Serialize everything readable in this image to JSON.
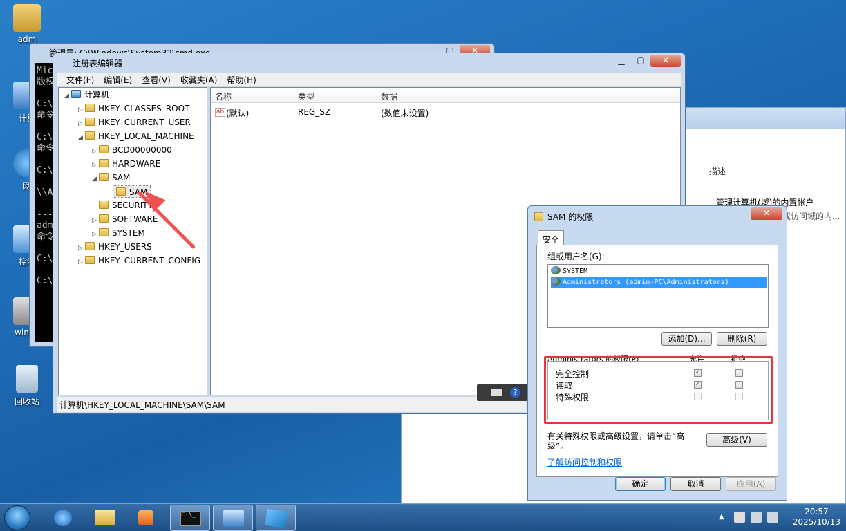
{
  "desktop": {
    "icons": [
      "adm",
      "计算",
      "网",
      "控制",
      "windo",
      "回收站"
    ]
  },
  "background_window": {
    "column_header": "描述",
    "row1": "管理计算机(域)的内置帐户",
    "row2": "供来宾访问计算机或访问域的内..."
  },
  "cmd": {
    "title": "管理员: C:\\Windows\\System32\\cmd.exe",
    "lines": [
      "Mic",
      "版权",
      "",
      "C:\\",
      "命令",
      "",
      "C:\\",
      "命令",
      "",
      "C:\\",
      "",
      "\\\\A",
      "",
      "---",
      "adm",
      "命令",
      "",
      "C:\\",
      "",
      "C:\\"
    ]
  },
  "regedit": {
    "title": "注册表编辑器",
    "menu": [
      "文件(F)",
      "编辑(E)",
      "查看(V)",
      "收藏夹(A)",
      "帮助(H)"
    ],
    "tree": {
      "root": "计算机",
      "hkcr": "HKEY_CLASSES_ROOT",
      "hkcu": "HKEY_CURRENT_USER",
      "hklm": "HKEY_LOCAL_MACHINE",
      "bcd": "BCD00000000",
      "hardware": "HARDWARE",
      "sam": "SAM",
      "sam_child": "SAM",
      "security": "SECURITY",
      "software": "SOFTWARE",
      "system": "SYSTEM",
      "hku": "HKEY_USERS",
      "hkcc": "HKEY_CURRENT_CONFIG"
    },
    "columns": {
      "name": "名称",
      "type": "类型",
      "data": "数据"
    },
    "row": {
      "name": "(默认)",
      "type": "REG_SZ",
      "data": "(数值未设置)",
      "icon": "ab"
    },
    "status": "计算机\\HKEY_LOCAL_MACHINE\\SAM\\SAM"
  },
  "perm_dialog": {
    "title": "SAM 的权限",
    "tab": "安全",
    "group_label": "组或用户名(G):",
    "users": [
      "SYSTEM",
      "Administrators (admin-PC\\Administrators)"
    ],
    "add": "添加(D)...",
    "remove": "删除(R)",
    "perm_header": "Administrators 的权限(P)",
    "allow": "允许",
    "deny": "拒绝",
    "perms": [
      {
        "name": "完全控制",
        "allow": true,
        "deny": false
      },
      {
        "name": "读取",
        "allow": true,
        "deny": false
      },
      {
        "name": "特殊权限",
        "allow": false,
        "deny": false
      }
    ],
    "advanced_text": "有关特殊权限或高级设置，请单击“高级”。",
    "advanced_btn": "高级(V)",
    "link": "了解访问控制和权限",
    "ok": "确定",
    "cancel": "取消",
    "apply": "应用(A)"
  },
  "taskbar": {
    "time": "20:57",
    "date": "2025/10/13"
  }
}
